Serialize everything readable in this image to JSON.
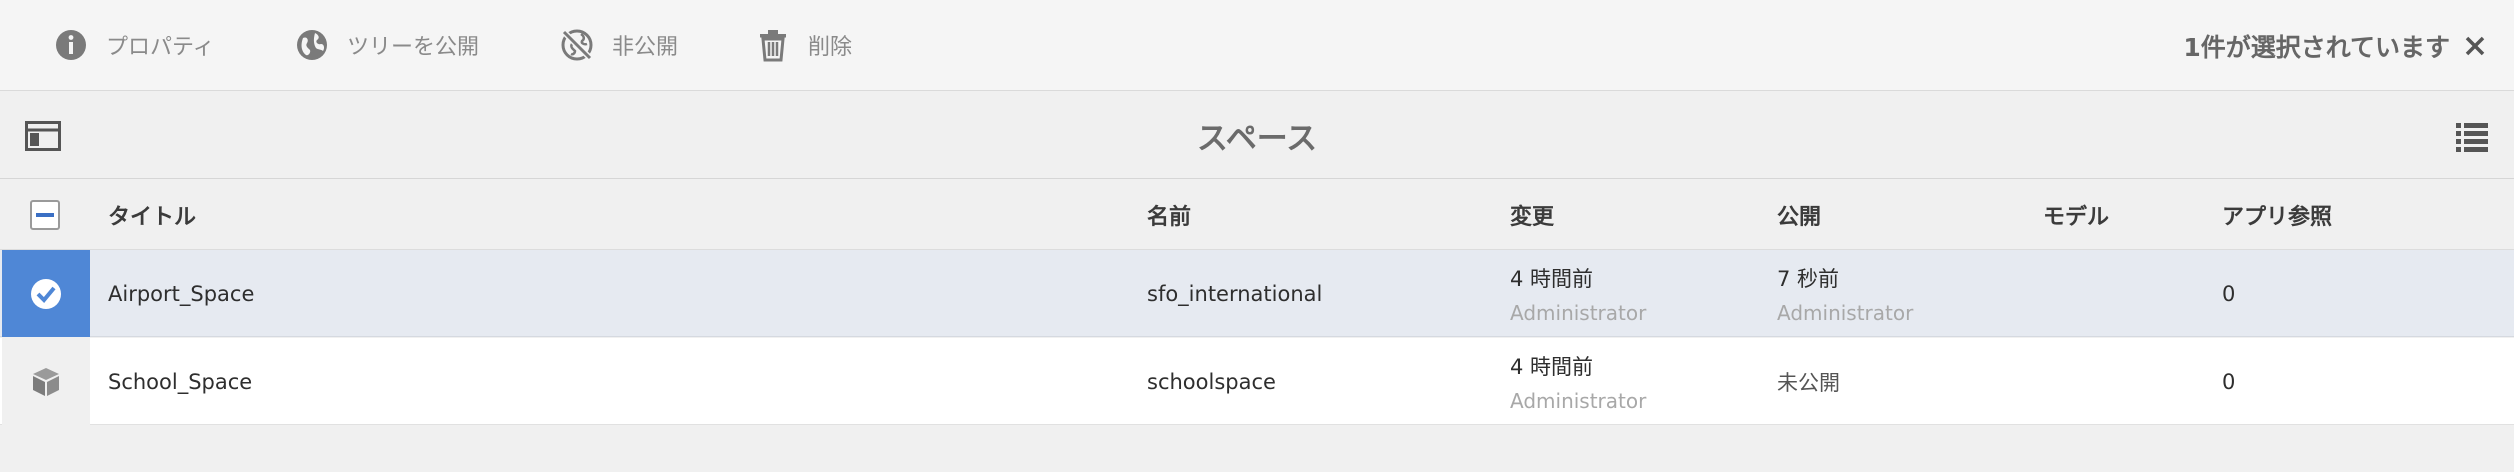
{
  "toolbar": {
    "properties_label": "プロパティ",
    "publish_tree_label": "ツリーを公開",
    "unpublish_label": "非公開",
    "delete_label": "削除",
    "selection_text": "1件が選択されています"
  },
  "header": {
    "title": "スペース"
  },
  "table": {
    "columns": {
      "title": "タイトル",
      "name": "名前",
      "modified": "変更",
      "published": "公開",
      "model": "モデル",
      "app_refs": "アプリ参照"
    },
    "rows": [
      {
        "title": "Airport_Space",
        "name": "sfo_international",
        "modified": "4 時間前",
        "modified_by": "Administrator",
        "published": "7 秒前",
        "published_by": "Administrator",
        "model": "",
        "app_refs": "0",
        "selected": true
      },
      {
        "title": "School_Space",
        "name": "schoolspace",
        "modified": "4 時間前",
        "modified_by": "Administrator",
        "published": "未公開",
        "published_by": "",
        "model": "",
        "app_refs": "0",
        "selected": false
      }
    ]
  },
  "colors": {
    "selected_thumb": "#4f87d6",
    "selected_row": "#e6eaf1",
    "checkbox_accent": "#3a6fc4"
  },
  "icons": [
    "info-icon",
    "globe-icon",
    "unpublish-globe-icon",
    "trash-icon",
    "close-icon",
    "rail-toggle-icon",
    "list-view-icon",
    "check-icon",
    "box-icon"
  ]
}
